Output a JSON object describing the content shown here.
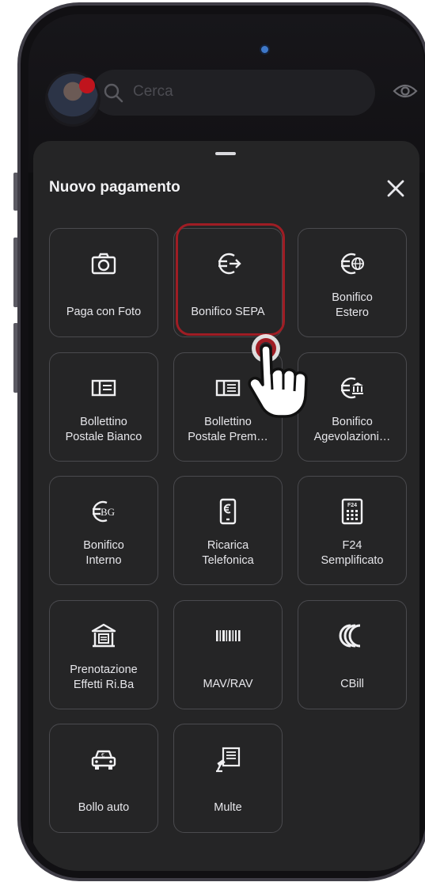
{
  "background": {
    "search_placeholder": "Cerca"
  },
  "sheet": {
    "title": "Nuovo pagamento",
    "close_icon": "close-icon"
  },
  "tiles": [
    {
      "label": "Paga con Foto",
      "icon": "camera-icon"
    },
    {
      "label": "Bonifico SEPA",
      "icon": "euro-transfer-icon",
      "highlighted": true
    },
    {
      "label": "Bonifico\nEstero",
      "icon": "euro-globe-icon"
    },
    {
      "label": "Bollettino\nPostale Bianco",
      "icon": "postal-slip-icon"
    },
    {
      "label": "Bollettino\nPostale Prem…",
      "icon": "postal-slip-printed-icon"
    },
    {
      "label": "Bonifico\nAgevolazioni…",
      "icon": "euro-bank-icon"
    },
    {
      "label": "Bonifico\nInterno",
      "icon": "euro-bg-icon"
    },
    {
      "label": "Ricarica\nTelefonica",
      "icon": "phone-euro-icon"
    },
    {
      "label": "F24\nSemplificato",
      "icon": "f24-form-icon"
    },
    {
      "label": "Prenotazione\nEffetti Ri.Ba",
      "icon": "bank-building-icon"
    },
    {
      "label": "MAV/RAV",
      "icon": "barcode-icon"
    },
    {
      "label": "CBill",
      "icon": "cbill-logo-icon"
    },
    {
      "label": "Bollo auto",
      "icon": "car-euro-icon"
    },
    {
      "label": "Multe",
      "icon": "fine-gavel-icon"
    }
  ],
  "colors": {
    "sheet_bg": "#252526",
    "tile_border": "#4a4a4e",
    "highlight": "#9f1d24",
    "text": "#e6e6ea"
  }
}
